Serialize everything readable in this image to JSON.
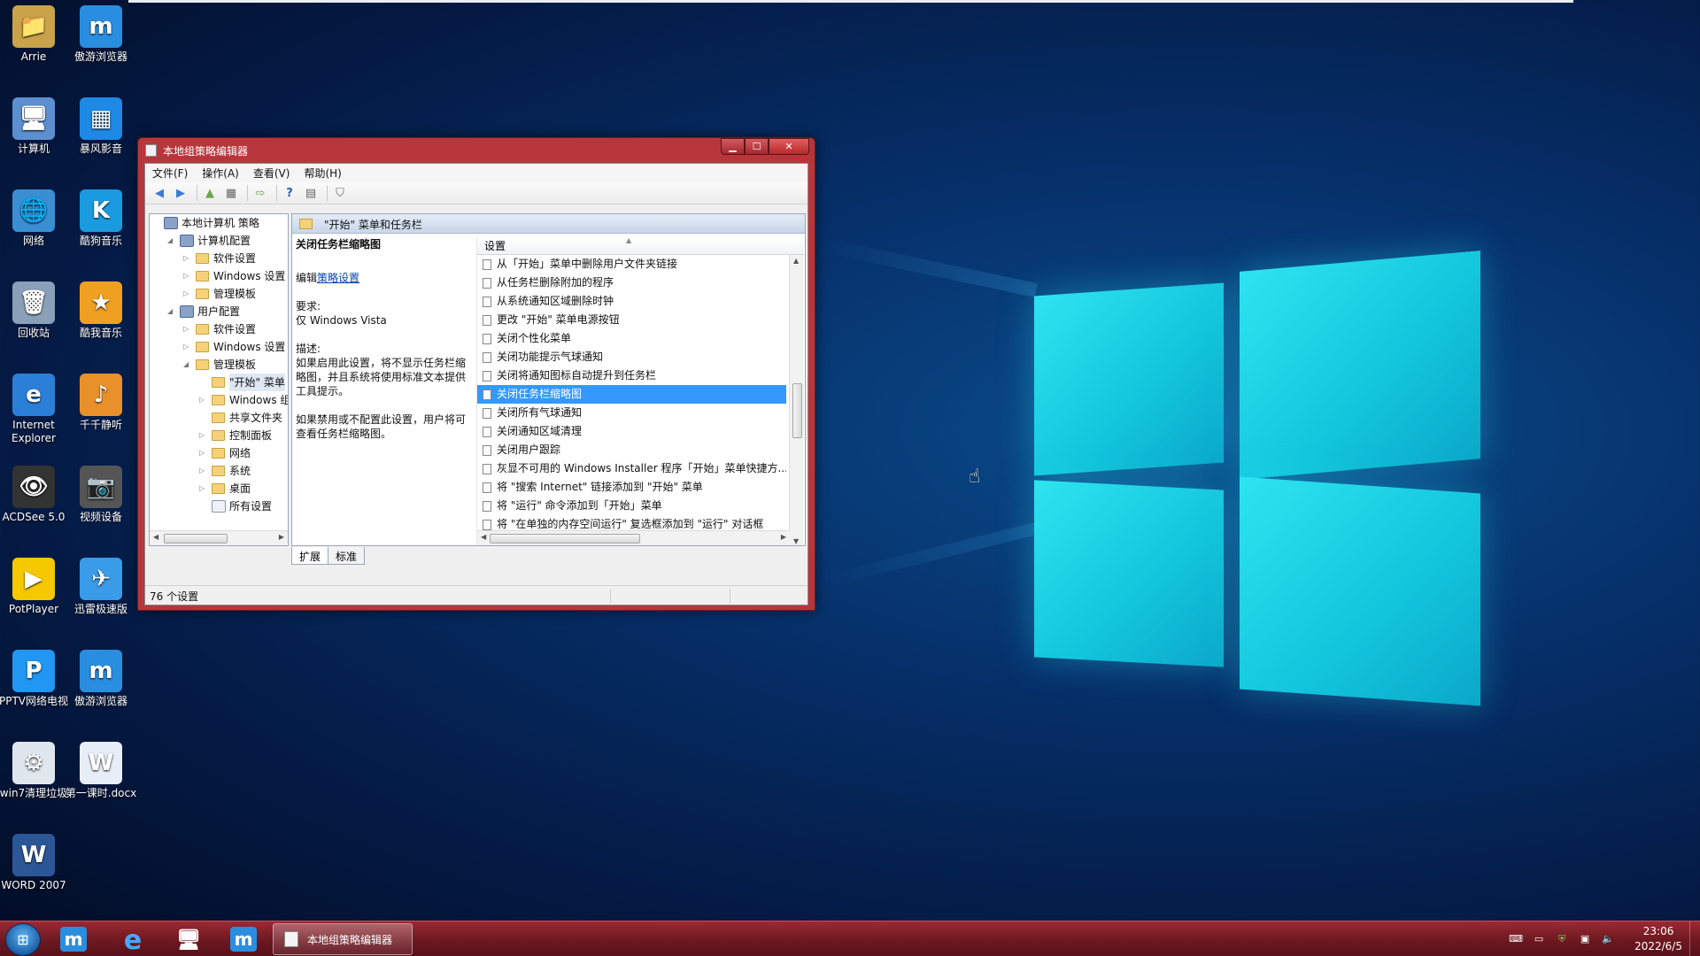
{
  "desktop": {
    "icons": [
      {
        "label": "Arrie",
        "icon": "user-folder-icon",
        "color": "#c9a24a"
      },
      {
        "label": "傲游浏览器",
        "icon": "maxthon-icon",
        "color": "#2a8ee0"
      },
      {
        "label": "计算机",
        "icon": "computer-icon",
        "color": "#5b8fd0"
      },
      {
        "label": "暴风影音",
        "icon": "baofeng-icon",
        "color": "#1e88e5"
      },
      {
        "label": "网络",
        "icon": "network-icon",
        "color": "#3a8fd3"
      },
      {
        "label": "酷狗音乐",
        "icon": "kugou-icon",
        "color": "#1a9be0"
      },
      {
        "label": "回收站",
        "icon": "recycle-bin-icon",
        "color": "#8aa0b8"
      },
      {
        "label": "酷我音乐",
        "icon": "kuwo-icon",
        "color": "#f0a020"
      },
      {
        "label": "Internet Explorer",
        "icon": "ie-icon",
        "color": "#2b7fd6"
      },
      {
        "label": "千千静听",
        "icon": "ttplayer-icon",
        "color": "#e8902a"
      },
      {
        "label": "ACDSee 5.0",
        "icon": "acdsee-icon",
        "color": "#333333"
      },
      {
        "label": "视频设备",
        "icon": "camera-icon",
        "color": "#555555"
      },
      {
        "label": "PotPlayer",
        "icon": "potplayer-icon",
        "color": "#f5c800"
      },
      {
        "label": "迅雷极速版",
        "icon": "thunder-icon",
        "color": "#3a9be8"
      },
      {
        "label": "PPTV网络电视",
        "icon": "pptv-icon",
        "color": "#2196f3"
      },
      {
        "label": "傲游浏览器",
        "icon": "maxthon-icon",
        "color": "#2a8ee0"
      },
      {
        "label": "win7清理垃圾",
        "icon": "cleaner-icon",
        "color": "#dfe6ee"
      },
      {
        "label": "第一课时.docx",
        "icon": "docx-icon",
        "color": "#e8eef8"
      },
      {
        "label": "WORD 2007",
        "icon": "word-icon",
        "color": "#2b5797"
      }
    ]
  },
  "window": {
    "title": "本地组策略编辑器",
    "menu": [
      "文件(F)",
      "操作(A)",
      "查看(V)",
      "帮助(H)"
    ],
    "tree": [
      {
        "label": "本地计算机 策略",
        "level": 0,
        "kind": "computer",
        "twisty": ""
      },
      {
        "label": "计算机配置",
        "level": 1,
        "kind": "computer",
        "twisty": "◢"
      },
      {
        "label": "软件设置",
        "level": 2,
        "kind": "folder",
        "twisty": "▷"
      },
      {
        "label": "Windows 设置",
        "level": 2,
        "kind": "folder",
        "twisty": "▷"
      },
      {
        "label": "管理模板",
        "level": 2,
        "kind": "folder",
        "twisty": "▷"
      },
      {
        "label": "用户配置",
        "level": 1,
        "kind": "computer",
        "twisty": "◢"
      },
      {
        "label": "软件设置",
        "level": 2,
        "kind": "folder",
        "twisty": "▷"
      },
      {
        "label": "Windows 设置",
        "level": 2,
        "kind": "folder",
        "twisty": "▷"
      },
      {
        "label": "管理模板",
        "level": 2,
        "kind": "folder",
        "twisty": "◢"
      },
      {
        "label": "\"开始\" 菜单",
        "level": 3,
        "kind": "folder",
        "twisty": "",
        "selected": true
      },
      {
        "label": "Windows 组",
        "level": 3,
        "kind": "folder",
        "twisty": "▷"
      },
      {
        "label": "共享文件夹",
        "level": 3,
        "kind": "folder",
        "twisty": ""
      },
      {
        "label": "控制面板",
        "level": 3,
        "kind": "folder",
        "twisty": "▷"
      },
      {
        "label": "网络",
        "level": 3,
        "kind": "folder",
        "twisty": "▷"
      },
      {
        "label": "系统",
        "level": 3,
        "kind": "folder",
        "twisty": "▷"
      },
      {
        "label": "桌面",
        "level": 3,
        "kind": "folder",
        "twisty": "▷"
      },
      {
        "label": "所有设置",
        "level": 3,
        "kind": "settings",
        "twisty": ""
      }
    ],
    "header_title": "\"开始\" 菜单和任务栏",
    "description": {
      "heading": "关闭任务栏缩略图",
      "edit_prefix": "编辑",
      "edit_link": "策略设置",
      "req_label": "要求:",
      "req_value": "仅 Windows Vista",
      "desc_label": "描述:",
      "desc_p1": "如果启用此设置，将不显示任务栏缩略图，并且系统将使用标准文本提供工具提示。",
      "desc_p2": "如果禁用或不配置此设置，用户将可查看任务栏缩略图。"
    },
    "column_header": "设置",
    "settings": [
      {
        "label": "从「开始」菜单中删除用户文件夹链接"
      },
      {
        "label": "从任务栏删除附加的程序"
      },
      {
        "label": "从系统通知区域删除时钟"
      },
      {
        "label": "更改 \"开始\" 菜单电源按钮"
      },
      {
        "label": "关闭个性化菜单"
      },
      {
        "label": "关闭功能提示气球通知"
      },
      {
        "label": "关闭将通知图标自动提升到任务栏"
      },
      {
        "label": "关闭任务栏缩略图",
        "selected": true
      },
      {
        "label": "关闭所有气球通知"
      },
      {
        "label": "关闭通知区域清理"
      },
      {
        "label": "关闭用户跟踪"
      },
      {
        "label": "灰显不可用的 Windows Installer 程序「开始」菜单快捷方..."
      },
      {
        "label": "将 \"搜索 Internet\" 链接添加到 \"开始\" 菜单"
      },
      {
        "label": "将 \"运行\" 命令添加到「开始」菜单"
      },
      {
        "label": "将 \"在单独的内存空间运行\" 复选框添加到 \"运行\" 对话框"
      }
    ],
    "tabs": [
      "扩展",
      "标准"
    ],
    "status": "76 个设置"
  },
  "taskbar": {
    "active_task": "本地组策略编辑器",
    "pinned": [
      "maxthon-icon",
      "ie-icon",
      "computer-icon",
      "maxthon-icon"
    ],
    "time": "23:06",
    "date": "2022/6/5"
  }
}
